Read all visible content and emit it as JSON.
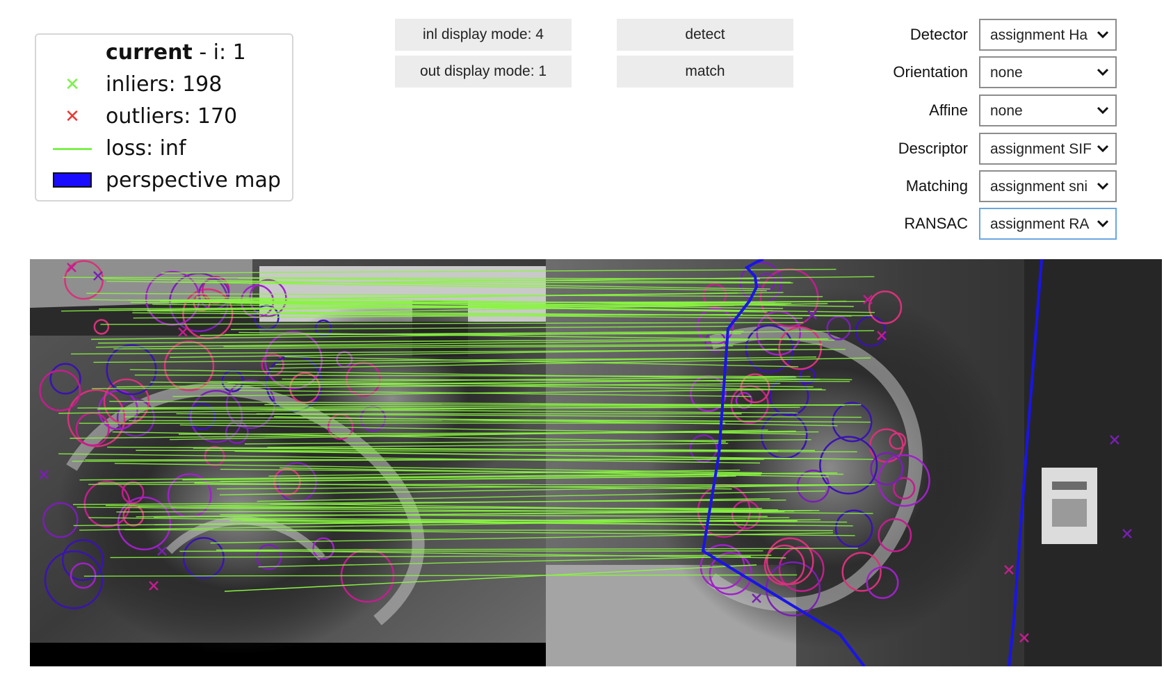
{
  "legend": {
    "title_bold": "current",
    "title_rest": " - i: 1",
    "inliers": "inliers: 198",
    "outliers": "outliers: 170",
    "loss": "loss: inf",
    "map": "perspective map",
    "inlier_color": "#7cf04c",
    "outlier_color": "#e53935",
    "map_color": "#1a0dff"
  },
  "buttons": {
    "inl_mode": "inl display mode: 4",
    "out_mode": "out display mode: 1",
    "detect": "detect",
    "match": "match"
  },
  "dropdowns": [
    {
      "label": "Detector",
      "value": "assignment Ha"
    },
    {
      "label": "Orientation",
      "value": "none"
    },
    {
      "label": "Affine",
      "value": "none"
    },
    {
      "label": "Descriptor",
      "value": "assignment SIF"
    },
    {
      "label": "Matching",
      "value": "assignment sni"
    },
    {
      "label": "RANSAC",
      "value": "assignment RA"
    }
  ],
  "viz": {
    "match_line_color": "#8af542",
    "circle_colors": [
      "#c41d8f",
      "#7a1fb5",
      "#3a13b0",
      "#d7327a",
      "#a021c9"
    ],
    "boundary_color": "#1a14e8"
  }
}
